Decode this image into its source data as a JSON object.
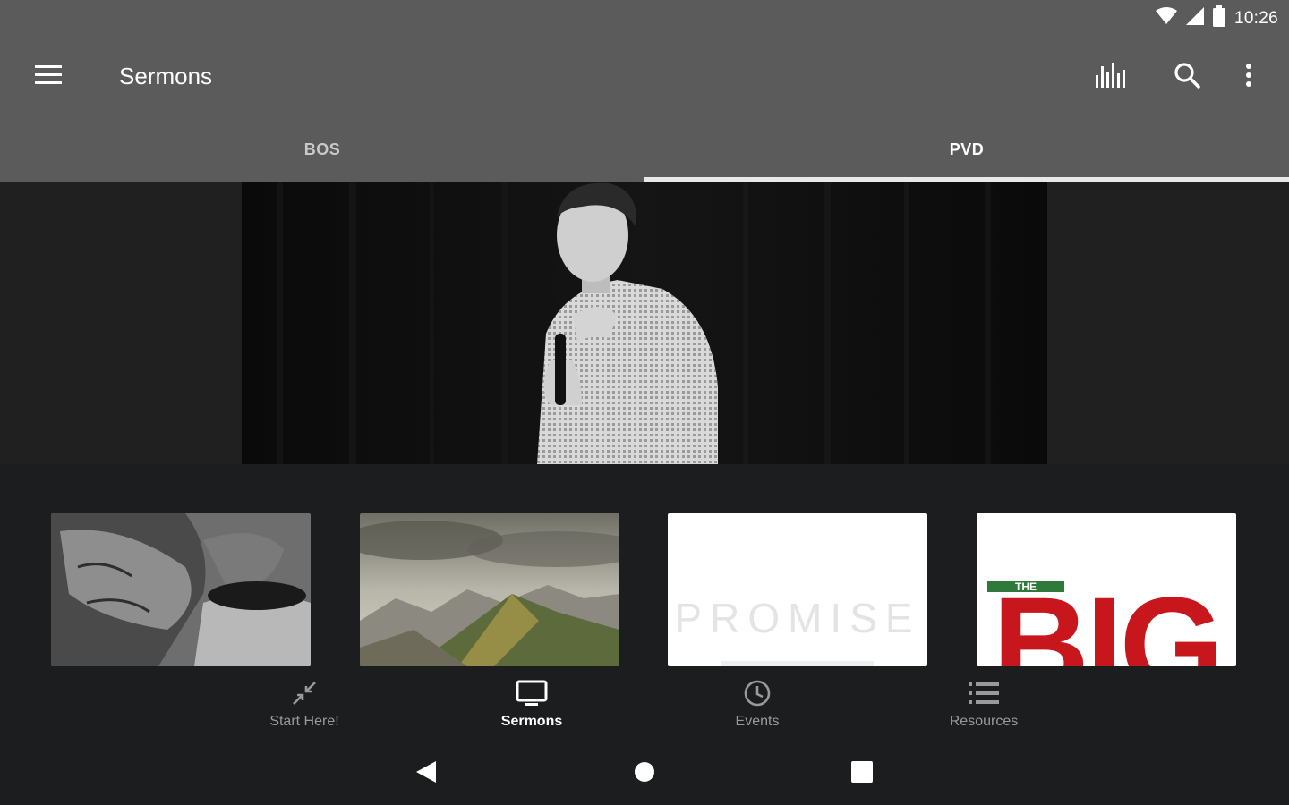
{
  "status_bar": {
    "time": "10:26",
    "icons": [
      "wifi-icon",
      "signal-icon",
      "battery-icon"
    ]
  },
  "toolbar": {
    "title": "Sermons",
    "menu_icon": "menu-icon",
    "actions": [
      "stats-icon",
      "search-icon",
      "more-vert-icon"
    ]
  },
  "tabs": [
    {
      "label": "BOS",
      "selected": false
    },
    {
      "label": "PVD",
      "selected": true
    }
  ],
  "hero": {
    "image": "speaker-with-microphone-photo"
  },
  "thumbnails": [
    {
      "image": "pottery-hands-photo"
    },
    {
      "image": "mountain-landscape-photo"
    },
    {
      "image": "promise-series-art",
      "text": "PROMISE"
    },
    {
      "image": "the-big-series-art",
      "text_small": "THE",
      "text_large": "BIG"
    }
  ],
  "bottom_nav": {
    "items": [
      {
        "label": "Start Here!",
        "icon": "collapse-arrows-icon",
        "selected": false
      },
      {
        "label": "Sermons",
        "icon": "tv-icon",
        "selected": true
      },
      {
        "label": "Events",
        "icon": "clock-icon",
        "selected": false
      },
      {
        "label": "Resources",
        "icon": "list-icon",
        "selected": false
      }
    ]
  },
  "system_nav": [
    "back-icon",
    "home-icon",
    "recents-icon"
  ],
  "colors": {
    "header_bg": "#5b5b5b",
    "body_bg": "#1c1d1f",
    "hero_side_bg": "#202020",
    "accent_red": "#c8161d",
    "accent_green": "#2f7a3a"
  }
}
